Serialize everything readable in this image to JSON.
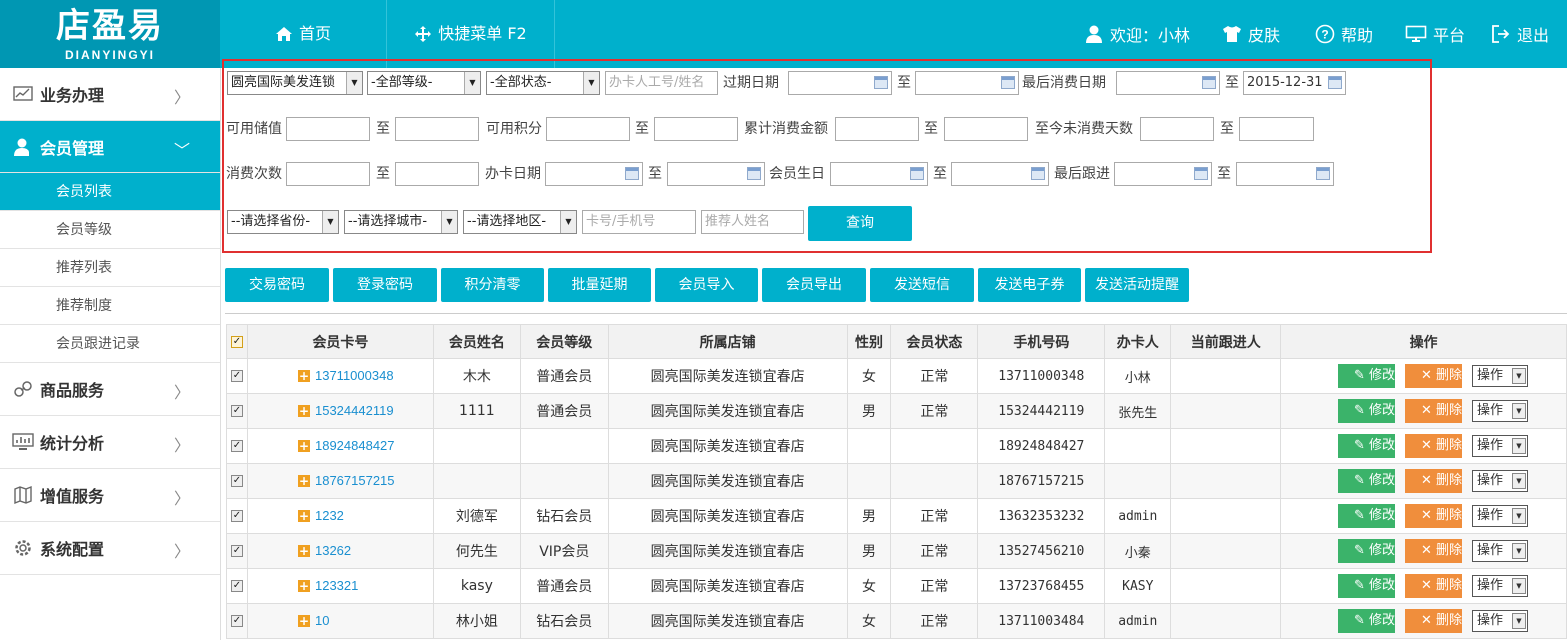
{
  "logo": {
    "title": "店盈易",
    "subtitle": "DIANYINGYI"
  },
  "topnav": {
    "home": "首页",
    "quick_menu": "快捷菜单 F2",
    "welcome": "欢迎：小林",
    "skin": "皮肤",
    "help": "帮助",
    "platform": "平台",
    "logout": "退出"
  },
  "sidebar": {
    "business": "业务办理",
    "member_mgmt": "会员管理",
    "sub": [
      "会员列表",
      "会员等级",
      "推荐列表",
      "推荐制度",
      "会员跟进记录"
    ],
    "goods": "商品服务",
    "stats": "统计分析",
    "value_added": "增值服务",
    "system": "系统配置"
  },
  "filter": {
    "store_select": "圆亮国际美发连锁",
    "level_select": "-全部等级-",
    "status_select": "-全部状态-",
    "staff_placeholder": "办卡人工号/姓名",
    "expire_date": "过期日期",
    "to": "至",
    "last_consume_date": "最后消费日期",
    "last_consume_end": "2015-12-31",
    "available_balance": "可用储值",
    "available_points": "可用积分",
    "total_consume": "累计消费金额",
    "days_since": "至今未消费天数",
    "consume_count": "消费次数",
    "card_date": "办卡日期",
    "birthday": "会员生日",
    "last_follow": "最后跟进",
    "province": "--请选择省份-",
    "city": "--请选择城市-",
    "district": "--请选择地区-",
    "card_placeholder": "卡号/手机号",
    "referrer_placeholder": "推荐人姓名",
    "query": "查询"
  },
  "actions": [
    "交易密码",
    "登录密码",
    "积分清零",
    "批量延期",
    "会员导入",
    "会员导出",
    "发送短信",
    "发送电子券",
    "发送活动提醒"
  ],
  "table": {
    "headers": [
      "会员卡号",
      "会员姓名",
      "会员等级",
      "所属店铺",
      "性别",
      "会员状态",
      "手机号码",
      "办卡人",
      "当前跟进人",
      "操作"
    ],
    "edit": "修改",
    "delete": "删除",
    "op": "操作",
    "rows": [
      {
        "card": "13711000348",
        "name": "木木",
        "level": "普通会员",
        "store": "圆亮国际美发连锁宜春店",
        "gender": "女",
        "status": "正常",
        "phone": "13711000348",
        "staff": "小林",
        "follower": ""
      },
      {
        "card": "15324442119",
        "name": "1111",
        "level": "普通会员",
        "store": "圆亮国际美发连锁宜春店",
        "gender": "男",
        "status": "正常",
        "phone": "15324442119",
        "staff": "张先生",
        "follower": ""
      },
      {
        "card": "18924848427",
        "name": "",
        "level": "",
        "store": "圆亮国际美发连锁宜春店",
        "gender": "",
        "status": "",
        "phone": "18924848427",
        "staff": "",
        "follower": ""
      },
      {
        "card": "18767157215",
        "name": "",
        "level": "",
        "store": "圆亮国际美发连锁宜春店",
        "gender": "",
        "status": "",
        "phone": "18767157215",
        "staff": "",
        "follower": ""
      },
      {
        "card": "1232",
        "name": "刘德军",
        "level": "钻石会员",
        "store": "圆亮国际美发连锁宜春店",
        "gender": "男",
        "status": "正常",
        "phone": "13632353232",
        "staff": "admin",
        "follower": ""
      },
      {
        "card": "13262",
        "name": "何先生",
        "level": "VIP会员",
        "store": "圆亮国际美发连锁宜春店",
        "gender": "男",
        "status": "正常",
        "phone": "13527456210",
        "staff": "小秦",
        "follower": ""
      },
      {
        "card": "123321",
        "name": "kasy",
        "level": "普通会员",
        "store": "圆亮国际美发连锁宜春店",
        "gender": "女",
        "status": "正常",
        "phone": "13723768455",
        "staff": "KASY",
        "follower": ""
      },
      {
        "card": "10",
        "name": "林小姐",
        "level": "钻石会员",
        "store": "圆亮国际美发连锁宜春店",
        "gender": "女",
        "status": "正常",
        "phone": "13711003484",
        "staff": "admin",
        "follower": ""
      }
    ]
  },
  "colors": {
    "primary": "#00b0cc",
    "edit": "#3bb36a",
    "delete": "#f08e3c",
    "filter_border": "#e03030",
    "link": "#1a8fd0"
  }
}
